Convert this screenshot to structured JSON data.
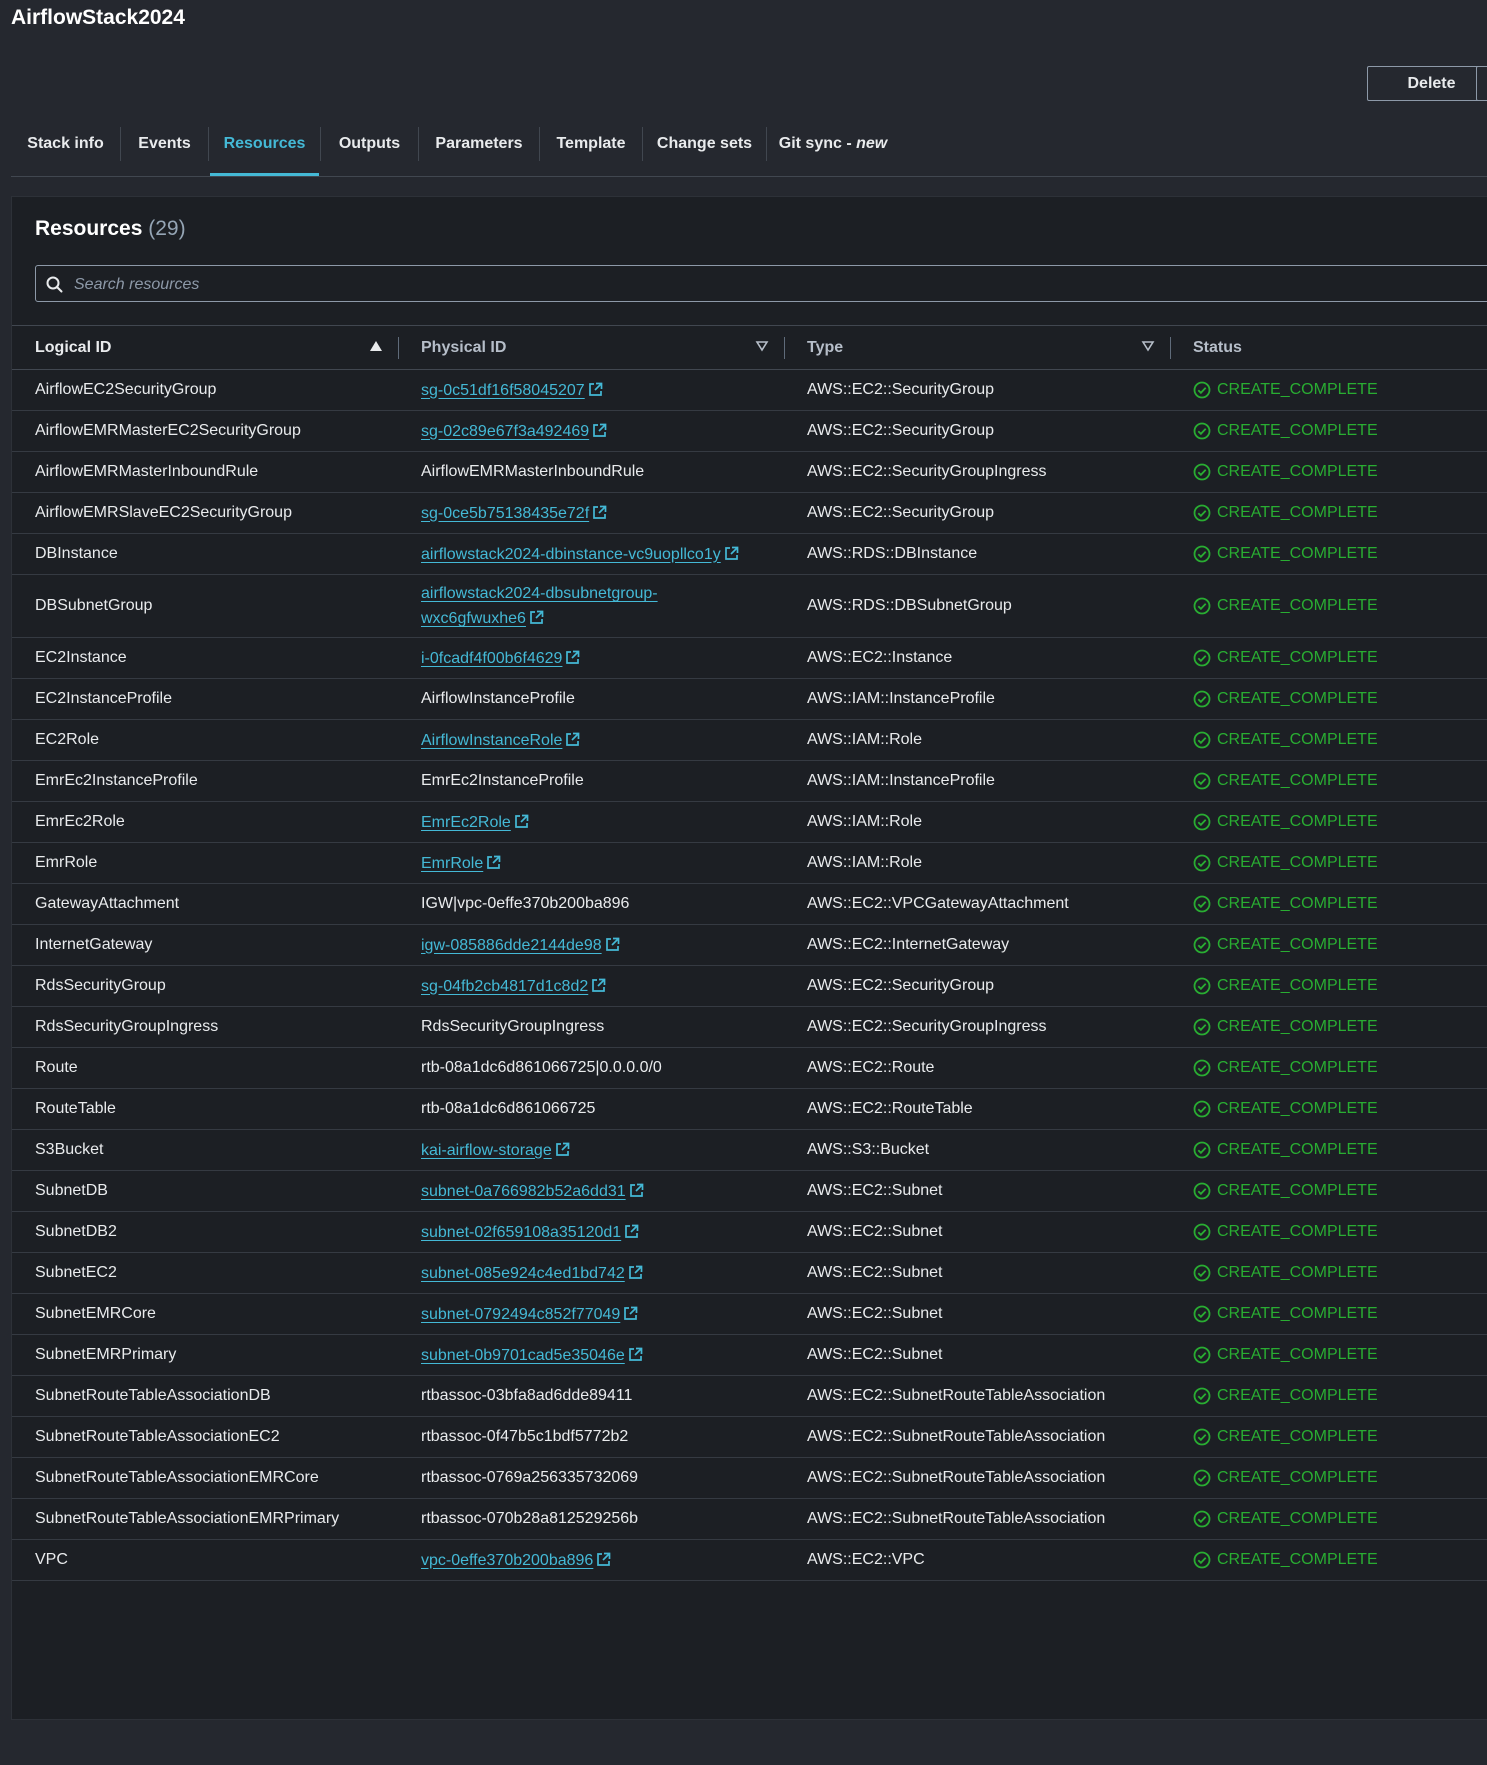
{
  "header": {
    "title": "AirflowStack2024",
    "delete_label": "Delete"
  },
  "tabs": [
    {
      "label": "Stack info"
    },
    {
      "label": "Events"
    },
    {
      "label": "Resources"
    },
    {
      "label": "Outputs"
    },
    {
      "label": "Parameters"
    },
    {
      "label": "Template"
    },
    {
      "label": "Change sets"
    },
    {
      "label": "Git sync - ",
      "badge": "new"
    }
  ],
  "active_tab": "Resources",
  "panel": {
    "title": "Resources",
    "count": "(29)",
    "search_placeholder": "Search resources"
  },
  "table": {
    "columns": [
      "Logical ID",
      "Physical ID",
      "Type",
      "Status"
    ],
    "sort_column": "Logical ID",
    "sort_direction": "ascending",
    "rows": [
      {
        "logical_id": "AirflowEC2SecurityGroup",
        "physical_id": "sg-0c51df16f58045207",
        "link": true,
        "type": "AWS::EC2::SecurityGroup",
        "status": "CREATE_COMPLETE"
      },
      {
        "logical_id": "AirflowEMRMasterEC2SecurityGroup",
        "physical_id": "sg-02c89e67f3a492469",
        "link": true,
        "type": "AWS::EC2::SecurityGroup",
        "status": "CREATE_COMPLETE"
      },
      {
        "logical_id": "AirflowEMRMasterInboundRule",
        "physical_id": "AirflowEMRMasterInboundRule",
        "link": false,
        "type": "AWS::EC2::SecurityGroupIngress",
        "status": "CREATE_COMPLETE"
      },
      {
        "logical_id": "AirflowEMRSlaveEC2SecurityGroup",
        "physical_id": "sg-0ce5b75138435e72f",
        "link": true,
        "type": "AWS::EC2::SecurityGroup",
        "status": "CREATE_COMPLETE"
      },
      {
        "logical_id": "DBInstance",
        "physical_id": "airflowstack2024-dbinstance-vc9uopllco1y",
        "link": true,
        "type": "AWS::RDS::DBInstance",
        "status": "CREATE_COMPLETE"
      },
      {
        "logical_id": "DBSubnetGroup",
        "physical_id": "airflowstack2024-dbsubnetgroup-wxc6gfwuxhe6",
        "link": true,
        "type": "AWS::RDS::DBSubnetGroup",
        "status": "CREATE_COMPLETE",
        "tall": true
      },
      {
        "logical_id": "EC2Instance",
        "physical_id": "i-0fcadf4f00b6f4629",
        "link": true,
        "type": "AWS::EC2::Instance",
        "status": "CREATE_COMPLETE"
      },
      {
        "logical_id": "EC2InstanceProfile",
        "physical_id": "AirflowInstanceProfile",
        "link": false,
        "type": "AWS::IAM::InstanceProfile",
        "status": "CREATE_COMPLETE"
      },
      {
        "logical_id": "EC2Role",
        "physical_id": "AirflowInstanceRole",
        "link": true,
        "type": "AWS::IAM::Role",
        "status": "CREATE_COMPLETE"
      },
      {
        "logical_id": "EmrEc2InstanceProfile",
        "physical_id": "EmrEc2InstanceProfile",
        "link": false,
        "type": "AWS::IAM::InstanceProfile",
        "status": "CREATE_COMPLETE"
      },
      {
        "logical_id": "EmrEc2Role",
        "physical_id": "EmrEc2Role",
        "link": true,
        "type": "AWS::IAM::Role",
        "status": "CREATE_COMPLETE"
      },
      {
        "logical_id": "EmrRole",
        "physical_id": "EmrRole",
        "link": true,
        "type": "AWS::IAM::Role",
        "status": "CREATE_COMPLETE"
      },
      {
        "logical_id": "GatewayAttachment",
        "physical_id": "IGW|vpc-0effe370b200ba896",
        "link": false,
        "type": "AWS::EC2::VPCGatewayAttachment",
        "status": "CREATE_COMPLETE"
      },
      {
        "logical_id": "InternetGateway",
        "physical_id": "igw-085886dde2144de98",
        "link": true,
        "type": "AWS::EC2::InternetGateway",
        "status": "CREATE_COMPLETE"
      },
      {
        "logical_id": "RdsSecurityGroup",
        "physical_id": "sg-04fb2cb4817d1c8d2",
        "link": true,
        "type": "AWS::EC2::SecurityGroup",
        "status": "CREATE_COMPLETE"
      },
      {
        "logical_id": "RdsSecurityGroupIngress",
        "physical_id": "RdsSecurityGroupIngress",
        "link": false,
        "type": "AWS::EC2::SecurityGroupIngress",
        "status": "CREATE_COMPLETE"
      },
      {
        "logical_id": "Route",
        "physical_id": "rtb-08a1dc6d861066725|0.0.0.0/0",
        "link": false,
        "type": "AWS::EC2::Route",
        "status": "CREATE_COMPLETE"
      },
      {
        "logical_id": "RouteTable",
        "physical_id": "rtb-08a1dc6d861066725",
        "link": false,
        "type": "AWS::EC2::RouteTable",
        "status": "CREATE_COMPLETE"
      },
      {
        "logical_id": "S3Bucket",
        "physical_id": "kai-airflow-storage",
        "link": true,
        "type": "AWS::S3::Bucket",
        "status": "CREATE_COMPLETE"
      },
      {
        "logical_id": "SubnetDB",
        "physical_id": "subnet-0a766982b52a6dd31",
        "link": true,
        "type": "AWS::EC2::Subnet",
        "status": "CREATE_COMPLETE"
      },
      {
        "logical_id": "SubnetDB2",
        "physical_id": "subnet-02f659108a35120d1",
        "link": true,
        "type": "AWS::EC2::Subnet",
        "status": "CREATE_COMPLETE"
      },
      {
        "logical_id": "SubnetEC2",
        "physical_id": "subnet-085e924c4ed1bd742",
        "link": true,
        "type": "AWS::EC2::Subnet",
        "status": "CREATE_COMPLETE"
      },
      {
        "logical_id": "SubnetEMRCore",
        "physical_id": "subnet-0792494c852f77049",
        "link": true,
        "type": "AWS::EC2::Subnet",
        "status": "CREATE_COMPLETE"
      },
      {
        "logical_id": "SubnetEMRPrimary",
        "physical_id": "subnet-0b9701cad5e35046e",
        "link": true,
        "type": "AWS::EC2::Subnet",
        "status": "CREATE_COMPLETE"
      },
      {
        "logical_id": "SubnetRouteTableAssociationDB",
        "physical_id": "rtbassoc-03bfa8ad6dde89411",
        "link": false,
        "type": "AWS::EC2::SubnetRouteTableAssociation",
        "status": "CREATE_COMPLETE"
      },
      {
        "logical_id": "SubnetRouteTableAssociationEC2",
        "physical_id": "rtbassoc-0f47b5c1bdf5772b2",
        "link": false,
        "type": "AWS::EC2::SubnetRouteTableAssociation",
        "status": "CREATE_COMPLETE"
      },
      {
        "logical_id": "SubnetRouteTableAssociationEMRCore",
        "physical_id": "rtbassoc-0769a256335732069",
        "link": false,
        "type": "AWS::EC2::SubnetRouteTableAssociation",
        "status": "CREATE_COMPLETE"
      },
      {
        "logical_id": "SubnetRouteTableAssociationEMRPrimary",
        "physical_id": "rtbassoc-070b28a812529256b",
        "link": false,
        "type": "AWS::EC2::SubnetRouteTableAssociation",
        "status": "CREATE_COMPLETE"
      },
      {
        "logical_id": "VPC",
        "physical_id": "vpc-0effe370b200ba896",
        "link": true,
        "type": "AWS::EC2::VPC",
        "status": "CREATE_COMPLETE"
      }
    ]
  },
  "colors": {
    "background": "#25282f",
    "panel": "#1c1f24",
    "link": "#44b9d6",
    "success": "#29ad32",
    "text": "#e9ebed"
  },
  "icons": {
    "search": "search-icon",
    "external_link": "external-link-icon",
    "status_ok": "check-circle-icon",
    "sort_asc": "sort-ascending-icon",
    "sort_none": "sort-icon"
  }
}
